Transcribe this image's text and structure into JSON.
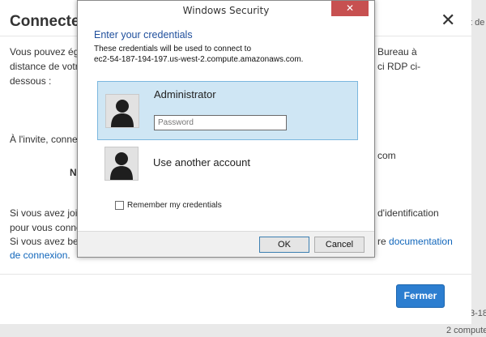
{
  "aws_modal": {
    "title": "Connecte",
    "close_symbol": "✕",
    "line1_left": "Vous pouvez ég",
    "line1_right": "Bureau à",
    "line2_left": "distance de votr",
    "line2_right": "ci RDP ci-",
    "line3": "dessous :",
    "prompt_left": "À l'invite, conne",
    "prompt_right": "com",
    "bold_fragment": "N",
    "p2_line1_left": "Si vous avez joi",
    "p2_line1_right": "d'identification",
    "p2_line2_left": "pour vous conne",
    "p2_line3_left": "Si vous avez be",
    "p2_line3_right_plain": "re",
    "p2_link_part1": "documentation",
    "p2_link_part2": "de connexion",
    "p2_link_trailing": ".",
    "close_button_label": "Fermer"
  },
  "background_page": {
    "header_fragment": "t de",
    "row_fragment_1": "3-18",
    "row_fragment_2": "2 compute"
  },
  "windows_security": {
    "window_title": "Windows Security",
    "close_symbol": "✕",
    "heading": "Enter your credentials",
    "description_line1": "These credentials will be used to connect to",
    "description_line2": "ec2-54-187-194-197.us-west-2.compute.amazonaws.com.",
    "accounts": [
      {
        "name": "Administrator",
        "selected": true
      },
      {
        "name": "Use another account",
        "selected": false
      }
    ],
    "password_placeholder": "Password",
    "password_value": "",
    "remember_label": "Remember my credentials",
    "remember_checked": false,
    "ok_label": "OK",
    "cancel_label": "Cancel"
  },
  "colors": {
    "accent_blue": "#1f4f9c",
    "selected_tile": "#cfe6f4",
    "close_red": "#c75050",
    "primary_button": "#2c7ed0",
    "link": "#1166bb"
  },
  "icons": {
    "avatar": "user-silhouette-icon",
    "close": "close-icon"
  }
}
